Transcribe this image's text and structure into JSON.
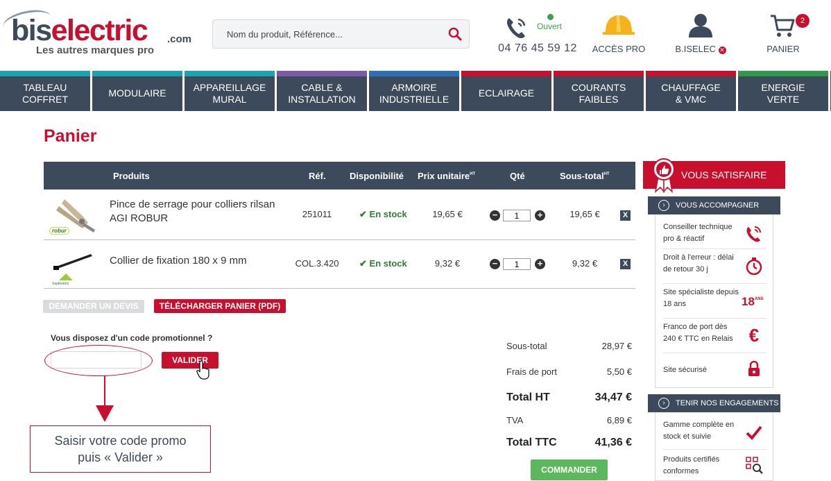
{
  "header": {
    "logo": {
      "brand_bis": "bis",
      "brand_electric": "electric",
      "domain": ".com",
      "tagline": "Les autres marques pro"
    },
    "search": {
      "placeholder": "Nom du produit, Référence..."
    },
    "phone": {
      "status": "Ouvert",
      "number": "04 76 45 59 12"
    },
    "pro": {
      "label": "ACCÈS PRO"
    },
    "user": {
      "label": "B.ISELEC"
    },
    "cart": {
      "label": "PANIER",
      "count": "2"
    }
  },
  "nav": [
    {
      "label": "TABLEAU\nCOFFRET",
      "color": "#1aa3b0"
    },
    {
      "label": "MODULAIRE",
      "color": "#1aa3b0"
    },
    {
      "label": "APPAREILLAGE\nMURAL",
      "color": "#1aa3b0"
    },
    {
      "label": "CABLE &\nINSTALLATION",
      "color": "#7b5aa6"
    },
    {
      "label": "ARMOIRE\nINDUSTRIELLE",
      "color": "#2e6db8"
    },
    {
      "label": "ECLAIRAGE",
      "color": "#c8102e"
    },
    {
      "label": "COURANTS\nFAIBLES",
      "color": "#c8102e"
    },
    {
      "label": "CHAUFFAGE\n& VMC",
      "color": "#c8102e"
    },
    {
      "label": "ENERGIE\nVERTE",
      "color": "#2e9a4a"
    }
  ],
  "page": {
    "title": "Panier"
  },
  "table": {
    "headers": {
      "products": "Produits",
      "ref": "Réf.",
      "dispo": "Disponibilité",
      "unit_price": "Prix unitaire",
      "unit_price_sup": "HT",
      "qty": "Qté",
      "subtotal": "Sous-total",
      "subtotal_sup": "HT"
    },
    "rows": [
      {
        "name_line1": "Pince de serrage pour colliers rilsan",
        "name_line2": "AGI ROBUR",
        "brand": "robur",
        "ref": "251011",
        "dispo": "En stock",
        "unit_price": "19,65 €",
        "qty": "1",
        "subtotal": "19,65 €",
        "delete": "X"
      },
      {
        "name_line1": "Collier de fixation 180 x 9 mm",
        "name_line2": "",
        "brand": "SapElektro",
        "ref": "COL.3.420",
        "dispo": "En stock",
        "unit_price": "9,32 €",
        "qty": "1",
        "subtotal": "9,32 €",
        "delete": "X"
      }
    ]
  },
  "actions": {
    "devis": "DEMANDER UN DEVIS",
    "pdf": "TÉLÉCHARGER PANIER (PDF)"
  },
  "promo": {
    "label": "Vous disposez d'un code promotionnel ?",
    "value": "",
    "button": "VALIDER",
    "callout_line1": "Saisir votre code promo",
    "callout_line2": "puis « Valider »"
  },
  "totals": {
    "subtotal_label": "Sous-total",
    "subtotal": "28,97 €",
    "shipping_label": "Frais de port",
    "shipping": "5,50 €",
    "total_ht_label": "Total HT",
    "total_ht": "34,47 €",
    "tva_label": "TVA",
    "tva": "6,89 €",
    "total_ttc_label": "Total TTC",
    "total_ttc": "41,36 €",
    "order_button": "COMMANDER"
  },
  "sidebar": {
    "header": "VOUS SATISFAIRE",
    "section1": {
      "title": "VOUS ACCOMPAGNER",
      "items": [
        {
          "text": "Conseiller technique pro & réactif",
          "icon": "phone-icon"
        },
        {
          "text": "Droit à l'erreur : délai de retour 30 j",
          "icon": "stopwatch-icon"
        },
        {
          "text": "Site spécialiste depuis 18 ans",
          "icon": "18-ans-icon",
          "badge": "18",
          "badge_small": "ANS"
        },
        {
          "text": "Franco de port dès 240 € TTC en Relais",
          "icon": "euro-icon"
        },
        {
          "text": "Site sécurisé",
          "icon": "lock-icon"
        }
      ]
    },
    "section2": {
      "title": "TENIR NOS ENGAGEMENTS",
      "items": [
        {
          "text": "Gamme complète en stock et suivie",
          "icon": "check-icon"
        },
        {
          "text": "Produits certifiés conformes",
          "icon": "qr-search-icon"
        }
      ]
    }
  },
  "colors": {
    "accent": "#c8102e",
    "navy": "#3c4a5c",
    "green": "#5cb85c"
  }
}
